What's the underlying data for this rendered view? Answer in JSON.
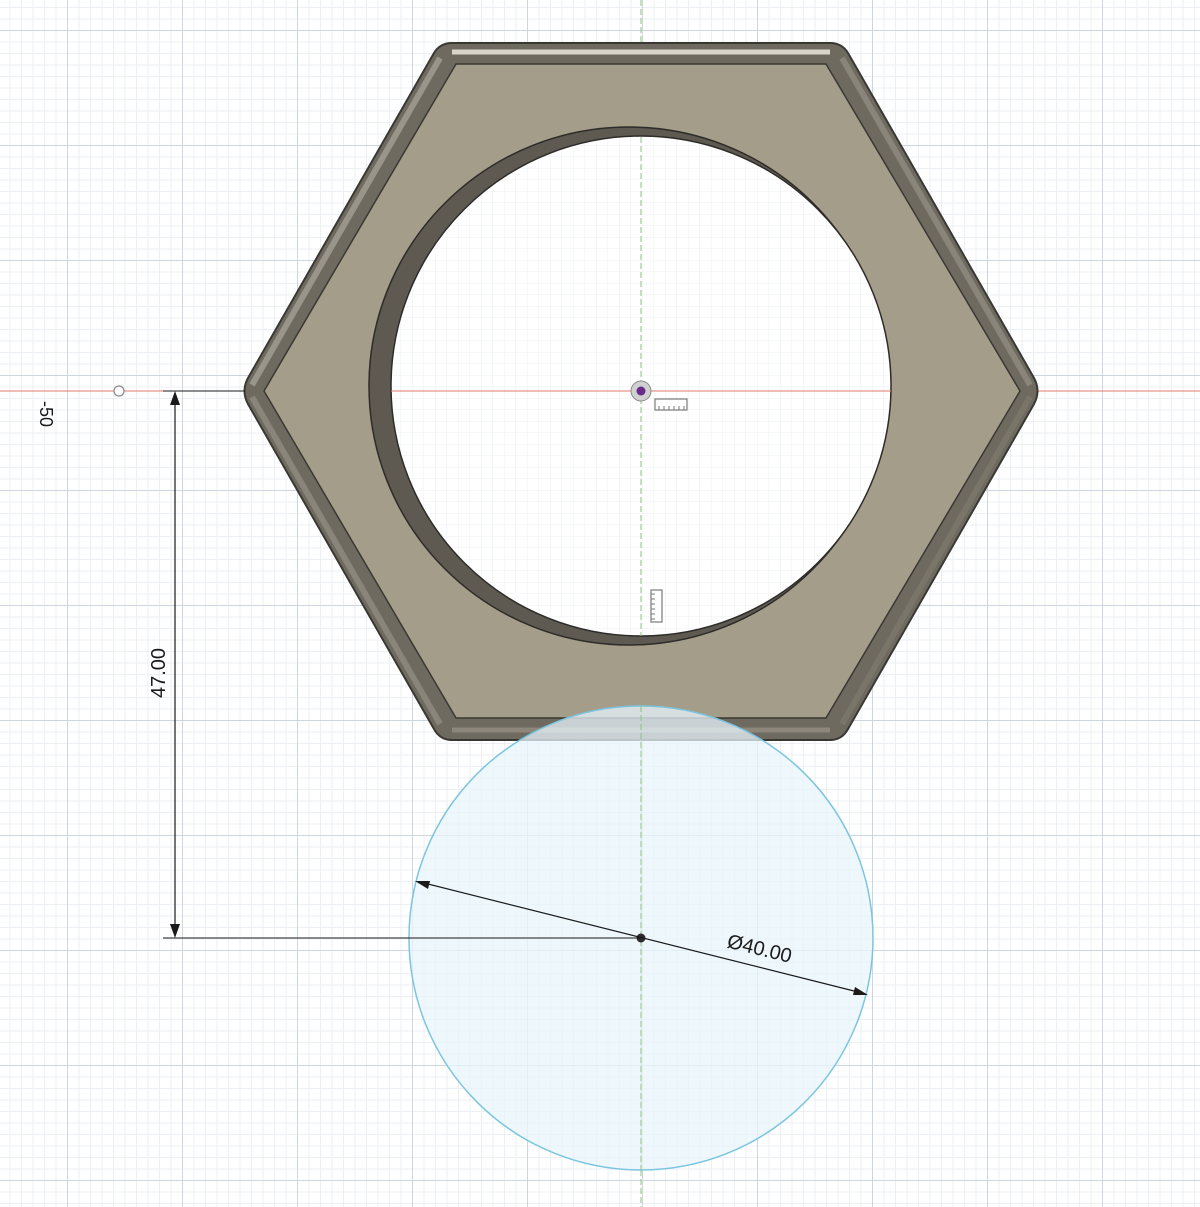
{
  "sketch": {
    "axis_label_x": "-50",
    "dimension_vertical": "47.00",
    "dimension_diameter": "Ø40.00"
  },
  "colors": {
    "part_face": "#a39d8a",
    "part_edge": "#4d4a44",
    "sketch_circle_fill": "#e8f4fb",
    "sketch_circle_stroke": "#7cc5e0",
    "x_axis": "#e07a6b",
    "y_axis": "#8bc37a"
  },
  "icons": [
    "origin-point-icon",
    "sketch-constraint-horizontal-icon",
    "sketch-constraint-vertical-icon"
  ]
}
